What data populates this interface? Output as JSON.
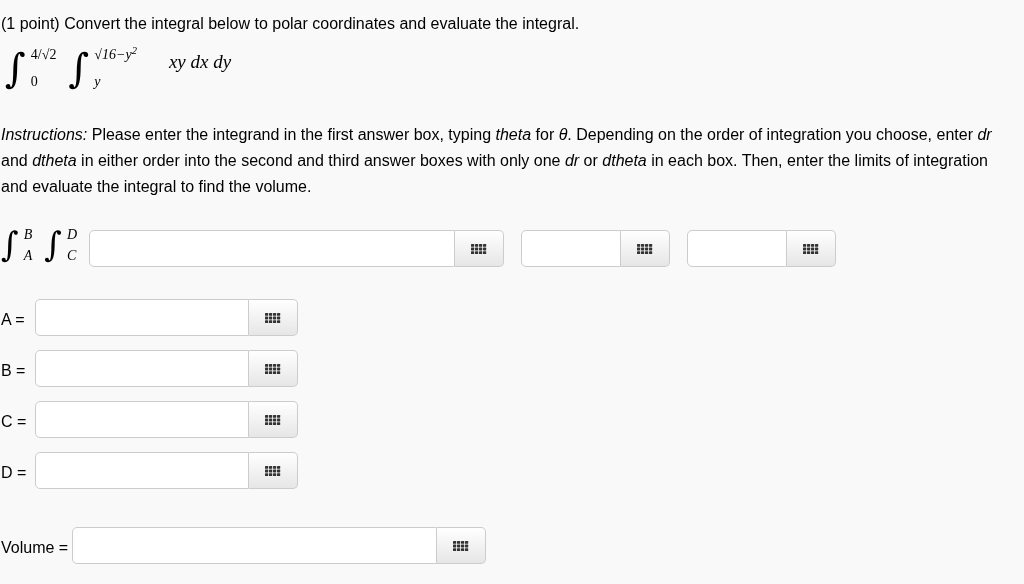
{
  "problem": {
    "header": "(1 point) Convert the integral below to polar coordinates and evaluate the integral.",
    "integral": {
      "sign": "∫",
      "outer_upper": "4/√2",
      "outer_lower": "0",
      "inner_upper": "√16−y$^{2}$",
      "inner_lower": "y",
      "integrand": "xy dx dy"
    },
    "instructions": "*Instructions:* Please enter the integrand in the first answer box, typing *theta* for *θ*. Depending on the order of integration you choose, enter *dr* and *dtheta* in either order into the second and third answer boxes with only one *dr* or *dtheta* in each box. Then, enter the limits of integration and evaluate the integral to find the volume."
  },
  "answer_integral": {
    "sign": "∫",
    "outer_upper": "B",
    "outer_lower": "A",
    "inner_upper": "D",
    "inner_lower": "C",
    "boxes": [
      {
        "kind": "wide"
      },
      {
        "kind": "narrow"
      },
      {
        "kind": "narrow"
      }
    ]
  },
  "limits": [
    {
      "label": "A ="
    },
    {
      "label": "B ="
    },
    {
      "label": "C ="
    },
    {
      "label": "D ="
    }
  ],
  "volume": {
    "label": "Volume ="
  }
}
